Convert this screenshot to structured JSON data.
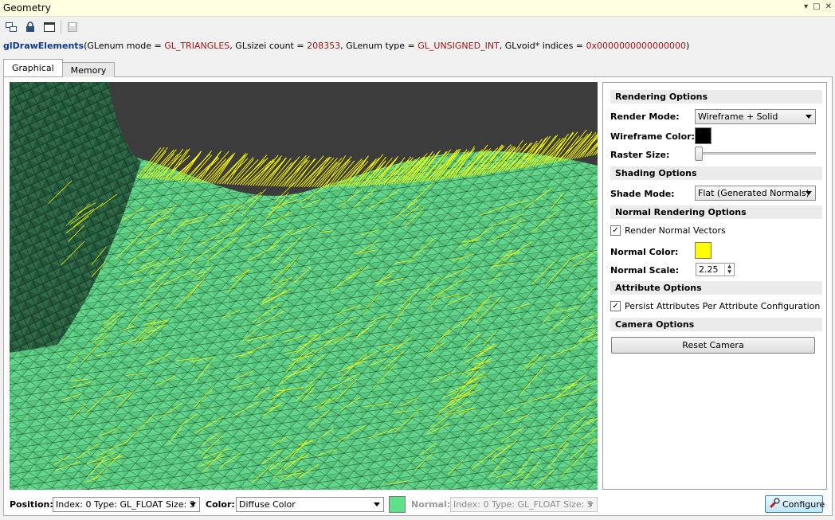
{
  "window": {
    "title": "Geometry",
    "controls": {
      "dropdown": "▾",
      "maximize": "□",
      "close": "✕"
    }
  },
  "toolbar": {
    "icons": [
      "windows-icon",
      "lock-icon",
      "window-icon",
      "save-icon"
    ]
  },
  "call": {
    "fn": "glDrawElements",
    "p1_prefix": "(GLenum mode = ",
    "p1_val": "GL_TRIANGLES",
    "p2_prefix": ", GLsizei count = ",
    "p2_val": "208353",
    "p3_prefix": ", GLenum type = ",
    "p3_val": "GL_UNSIGNED_INT",
    "p4_prefix": ", GLvoid* indices = ",
    "p4_val": "0x0000000000000000",
    "suffix": ")"
  },
  "tabs": [
    {
      "label": "Graphical",
      "active": true
    },
    {
      "label": "Memory",
      "active": false
    }
  ],
  "options": {
    "rendering_header": "Rendering Options",
    "render_mode_label": "Render Mode:",
    "render_mode_value": "Wireframe + Solid",
    "wireframe_color_label": "Wireframe Color:",
    "wireframe_color": "#000000",
    "raster_size_label": "Raster Size:",
    "raster_size_level": 0,
    "shading_header": "Shading Options",
    "shade_mode_label": "Shade Mode:",
    "shade_mode_value": "Flat (Generated Normals)",
    "normal_header": "Normal Rendering Options",
    "render_normals_label": "Render Normal Vectors",
    "render_normals_checked": true,
    "normal_color_label": "Normal Color:",
    "normal_color": "#ffff00",
    "normal_scale_label": "Normal Scale:",
    "normal_scale_value": "2.25",
    "attribute_header": "Attribute Options",
    "persist_label": "Persist Attributes Per Attribute Configuration",
    "persist_checked": true,
    "camera_header": "Camera Options",
    "reset_camera_label": "Reset Camera"
  },
  "bottom": {
    "position_label": "Position:",
    "position_value": "Index: 0 Type: GL_FLOAT Size: 3",
    "color_label": "Color:",
    "color_value": "Diffuse Color",
    "diffuse_swatch": "#5fe08a",
    "normal_label": "Normal:",
    "normal_value": "Index: 0 Type: GL_FLOAT Size: 3",
    "configure_label": "Configure"
  },
  "viewport": {
    "background": "#3c3c3c",
    "mesh_color": "#5fcf84",
    "normal_color": "#ffff00"
  }
}
